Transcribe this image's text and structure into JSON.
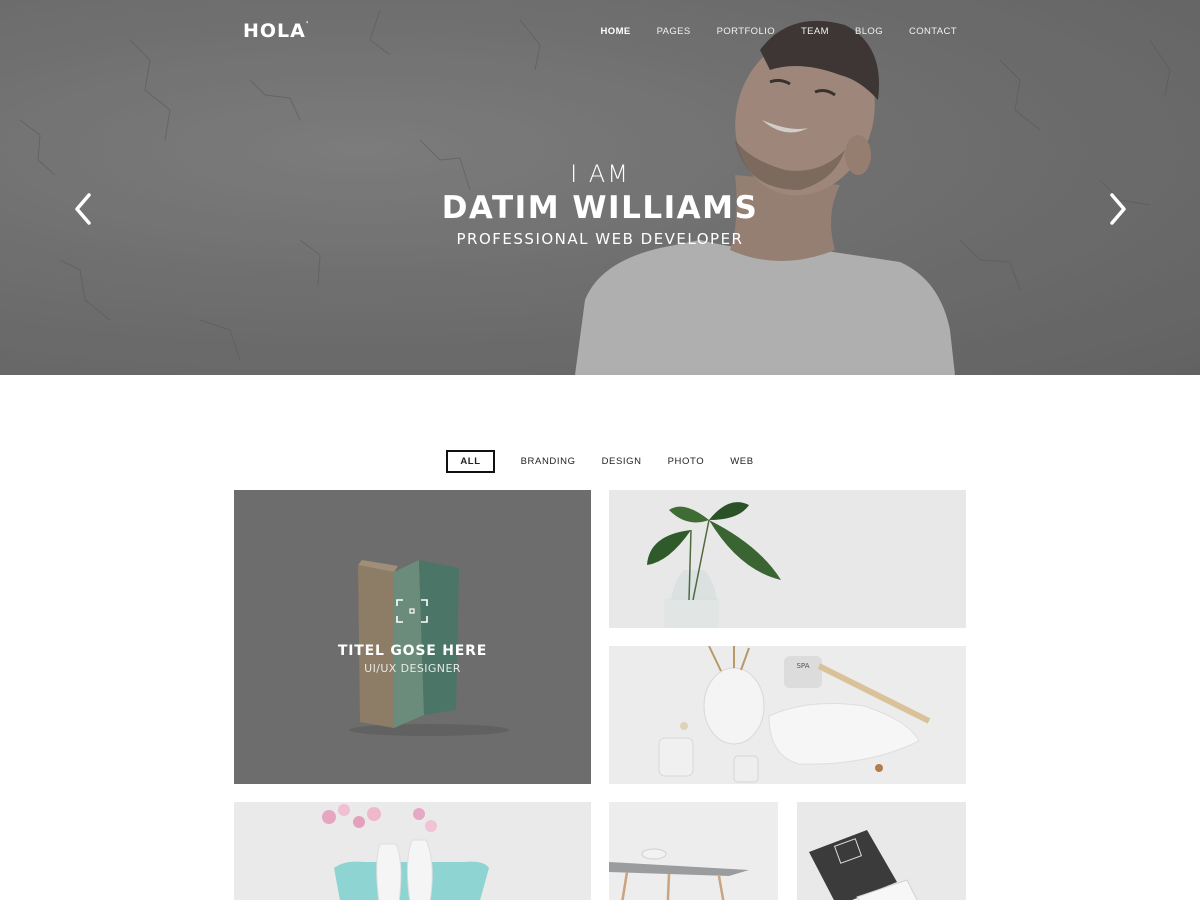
{
  "header": {
    "logo": "HOLA",
    "logo_mark": "'",
    "nav": [
      {
        "label": "HOME",
        "active": true
      },
      {
        "label": "PAGES",
        "active": false
      },
      {
        "label": "PORTFOLIO",
        "active": false
      },
      {
        "label": "TEAM",
        "active": false
      },
      {
        "label": "BLOG",
        "active": false
      },
      {
        "label": "CONTACT",
        "active": false
      }
    ]
  },
  "hero": {
    "pre": "I AM",
    "name": "DATIM WILLIAMS",
    "subtitle": "PROFESSIONAL WEB DEVELOPER",
    "prev_icon": "chevron-left-icon",
    "next_icon": "chevron-right-icon"
  },
  "portfolio": {
    "filters": [
      {
        "label": "ALL",
        "active": true
      },
      {
        "label": "BRANDING",
        "active": false
      },
      {
        "label": "DESIGN",
        "active": false
      },
      {
        "label": "PHOTO",
        "active": false
      },
      {
        "label": "WEB",
        "active": false
      }
    ],
    "featured": {
      "title": "TITEL GOSE HERE",
      "subtitle": "UI/UX DESIGNER",
      "icon": "expand-icon"
    },
    "spa_label": "SPA"
  },
  "colors": {
    "accent_teal": "#3f7f6c",
    "text_dark": "#111111",
    "hero_gray": "#7a7a7a"
  }
}
